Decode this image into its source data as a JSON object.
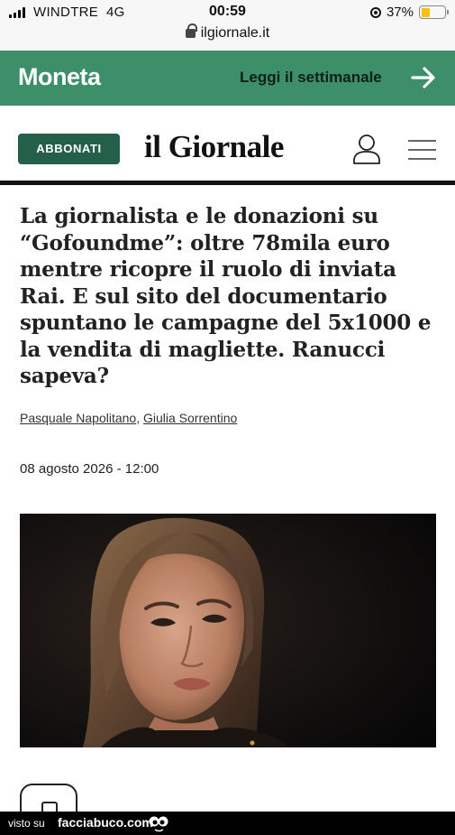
{
  "status_bar": {
    "carrier": "WINDTRE",
    "network": "4G",
    "time": "00:59",
    "url": "ilgiornale.it",
    "battery_percent": "37%",
    "battery_level": 0.37
  },
  "promo_banner": {
    "brand": "Moneta",
    "cta": "Leggi il settimanale",
    "background_color": "#3d8f6a"
  },
  "header": {
    "subscribe_label": "ABBONATI",
    "logo_text": "il Giornale",
    "brand_color": "#245f4a",
    "user_icon": "user-icon",
    "menu_icon": "hamburger-menu-icon"
  },
  "article": {
    "headline": "La giornalista e le donazioni su “Gofoundme”: oltre 78mila euro mentre ricopre il ruolo di inviata Rai. E sul sito del documentario spuntano le campagne del 5x1000 e la vendita di magliette. Ranucci sapeva?",
    "authors": [
      "Pasquale Napolitano",
      "Giulia Sorrentino"
    ],
    "author_separator": ",",
    "date": "08 agosto 2026 - 12:00"
  },
  "watermark": {
    "prefix": "visto su",
    "site": "facciabuco.com"
  }
}
